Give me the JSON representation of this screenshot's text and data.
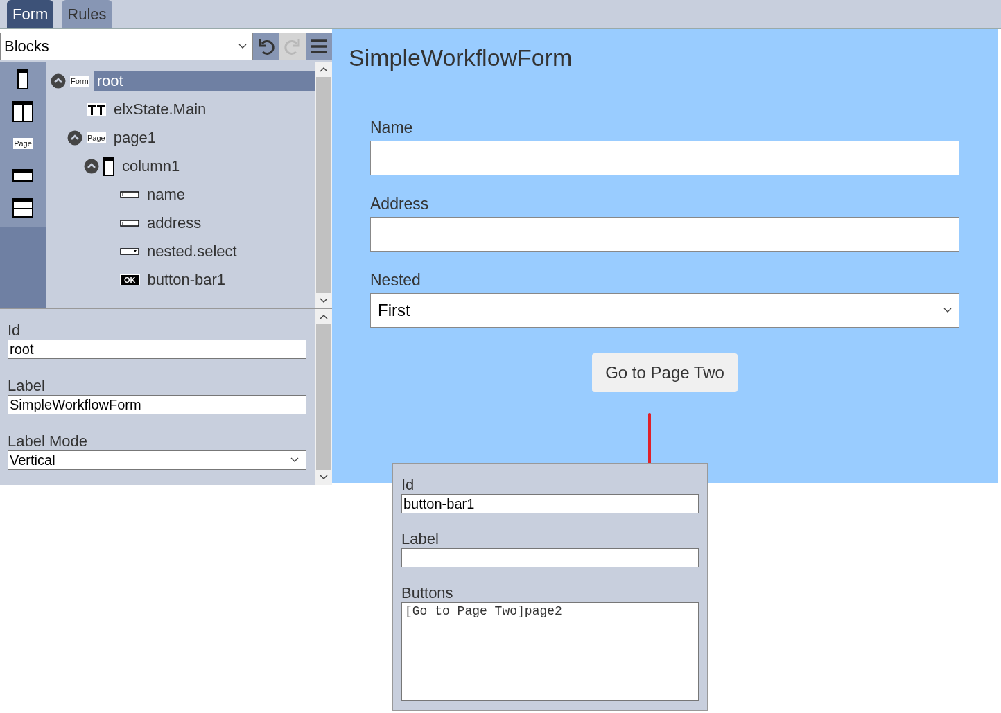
{
  "tabs": [
    {
      "label": "Form",
      "selected": true
    },
    {
      "label": "Rules",
      "selected": false
    }
  ],
  "toolbar": {
    "dropdown": {
      "value": "Blocks"
    },
    "buttons": [
      {
        "kind": "undo",
        "disabled": false
      },
      {
        "kind": "redo",
        "disabled": true
      },
      {
        "kind": "menu",
        "disabled": false
      }
    ]
  },
  "palette": [
    {
      "kind": "column"
    },
    {
      "kind": "columns"
    },
    {
      "kind": "page",
      "icon_label": "Page"
    },
    {
      "kind": "field"
    },
    {
      "kind": "panel"
    }
  ],
  "tree": [
    {
      "label": "root",
      "kind": "form",
      "icon_label": "Form",
      "selected": true,
      "expanded": true,
      "children": [
        {
          "label": "elxState.Main",
          "kind": "text",
          "selected": false
        },
        {
          "label": "page1",
          "kind": "page",
          "icon_label": "Page",
          "selected": false,
          "expanded": true,
          "children": [
            {
              "label": "column1",
              "kind": "column",
              "selected": false,
              "expanded": true,
              "children": [
                {
                  "label": "name",
                  "kind": "input",
                  "selected": false
                },
                {
                  "label": "address",
                  "kind": "input",
                  "selected": false
                },
                {
                  "label": "nested.select",
                  "kind": "select",
                  "selected": false
                },
                {
                  "label": "button-bar1",
                  "kind": "button",
                  "icon_label": "OK",
                  "selected": false
                }
              ]
            }
          ]
        }
      ]
    }
  ],
  "properties": [
    {
      "label": "Id",
      "kind": "text",
      "value": "root"
    },
    {
      "label": "Label",
      "kind": "text",
      "value": "SimpleWorkflowForm"
    },
    {
      "label": "Label Mode",
      "kind": "select",
      "value": "Vertical"
    }
  ],
  "preview": {
    "title": "SimpleWorkflowForm",
    "fields": [
      {
        "label": "Name",
        "kind": "text"
      },
      {
        "label": "Address",
        "kind": "text"
      },
      {
        "label": "Nested",
        "kind": "select",
        "value": "First"
      }
    ],
    "button": "Go to Page Two"
  },
  "popup": {
    "fields": [
      {
        "label": "Id",
        "kind": "text",
        "value": "button-bar1"
      },
      {
        "label": "Label",
        "kind": "text"
      },
      {
        "label": "Buttons",
        "kind": "textarea",
        "value": "[Go to Page Two]page2"
      }
    ]
  }
}
